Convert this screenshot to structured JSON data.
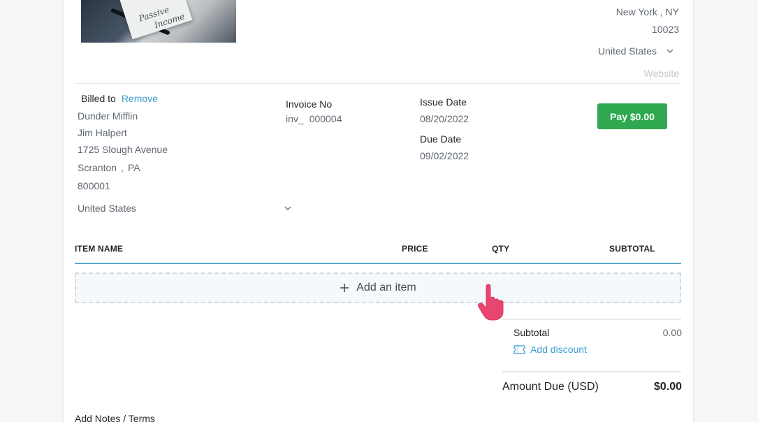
{
  "company": {
    "city_state": [
      "New York",
      ",",
      "NY"
    ],
    "zip": "10023",
    "country": "United States",
    "website_placeholder": "Website",
    "photo_text": [
      "Passive",
      "Income"
    ]
  },
  "billed_to": {
    "label": "Billed to",
    "remove_label": "Remove",
    "name": "Dunder Mifflin",
    "contact": "Jim Halpert",
    "street": "1725 Slough Avenue",
    "city": "Scranton",
    "state": "PA",
    "city_sep": ",",
    "zip": "800001",
    "country": "United States"
  },
  "invoice": {
    "number_label": "Invoice No",
    "prefix": "inv_",
    "number": "000004",
    "issue_label": "Issue Date",
    "issue_date": "08/20/2022",
    "due_label": "Due Date",
    "due_date": "09/02/2022"
  },
  "pay_button": "Pay $0.00",
  "table": {
    "headers": [
      "ITEM NAME",
      "PRICE",
      "QTY",
      "SUBTOTAL"
    ],
    "add_item_label": "Add an item"
  },
  "totals": {
    "subtotal_label": "Subtotal",
    "subtotal_value": "0.00",
    "discount_label": "Add discount",
    "amount_due_label": "Amount Due (USD)",
    "amount_due_value": "$0.00"
  },
  "notes_label": "Add Notes / Terms",
  "colors": {
    "accent": "#3a9fd0",
    "pay_button": "#2fa84f",
    "cursor": "#e8466f"
  }
}
